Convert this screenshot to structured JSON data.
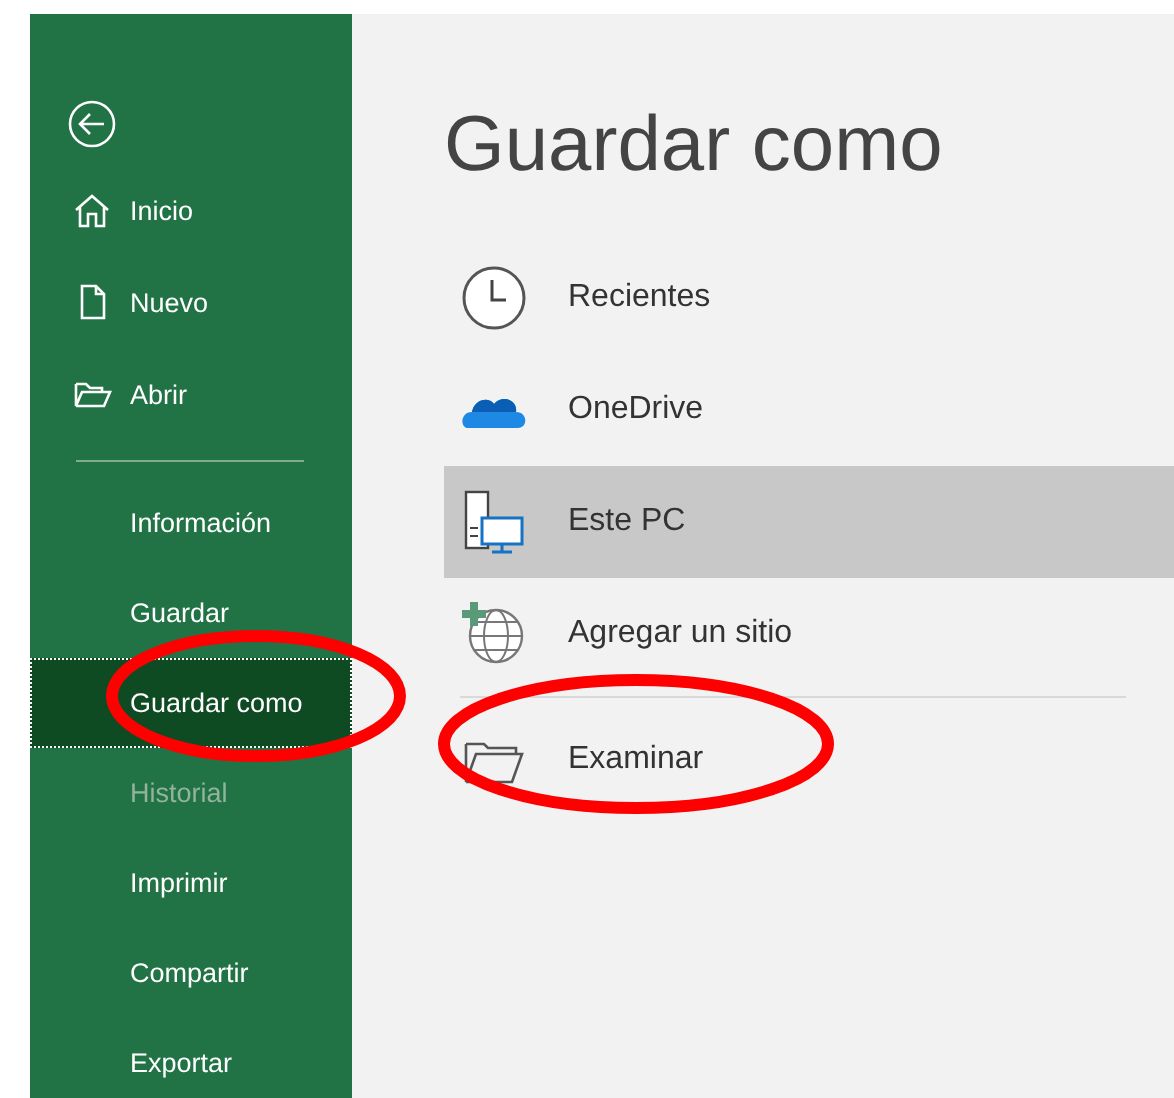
{
  "sidebar": {
    "top_items": [
      {
        "label": "Inicio"
      },
      {
        "label": "Nuevo"
      },
      {
        "label": "Abrir"
      }
    ],
    "items": [
      {
        "label": "Información",
        "selected": false,
        "disabled": false,
        "circled": false
      },
      {
        "label": "Guardar",
        "selected": false,
        "disabled": false,
        "circled": false
      },
      {
        "label": "Guardar como",
        "selected": true,
        "disabled": false,
        "circled": true
      },
      {
        "label": "Historial",
        "selected": false,
        "disabled": true,
        "circled": false
      },
      {
        "label": "Imprimir",
        "selected": false,
        "disabled": false,
        "circled": false
      },
      {
        "label": "Compartir",
        "selected": false,
        "disabled": false,
        "circled": false
      },
      {
        "label": "Exportar",
        "selected": false,
        "disabled": false,
        "circled": false
      }
    ]
  },
  "main": {
    "title": "Guardar como",
    "locations": [
      {
        "label": "Recientes",
        "selected": false,
        "circled": false
      },
      {
        "label": "OneDrive",
        "selected": false,
        "circled": false
      },
      {
        "label": "Este PC",
        "selected": true,
        "circled": false
      },
      {
        "label": "Agregar un sitio",
        "selected": false,
        "circled": false
      }
    ],
    "browse": {
      "label": "Examinar",
      "circled": true
    }
  }
}
